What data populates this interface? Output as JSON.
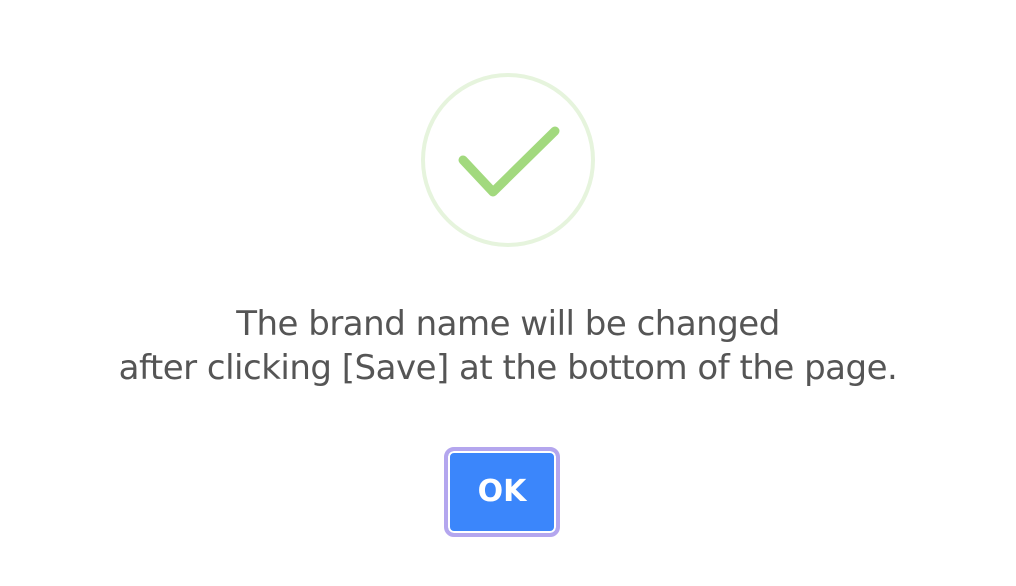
{
  "dialog": {
    "icon": "success-checkmark-icon",
    "message_line1": "The brand name will be changed",
    "message_line2": "after clicking [Save] at the bottom of the page.",
    "ok_label": "OK"
  },
  "colors": {
    "icon_ring": "#e6f4dd",
    "icon_check": "#a2d97e",
    "button_bg": "#3b86fb",
    "button_focus_ring": "#b4a6ee",
    "text": "#555555"
  }
}
